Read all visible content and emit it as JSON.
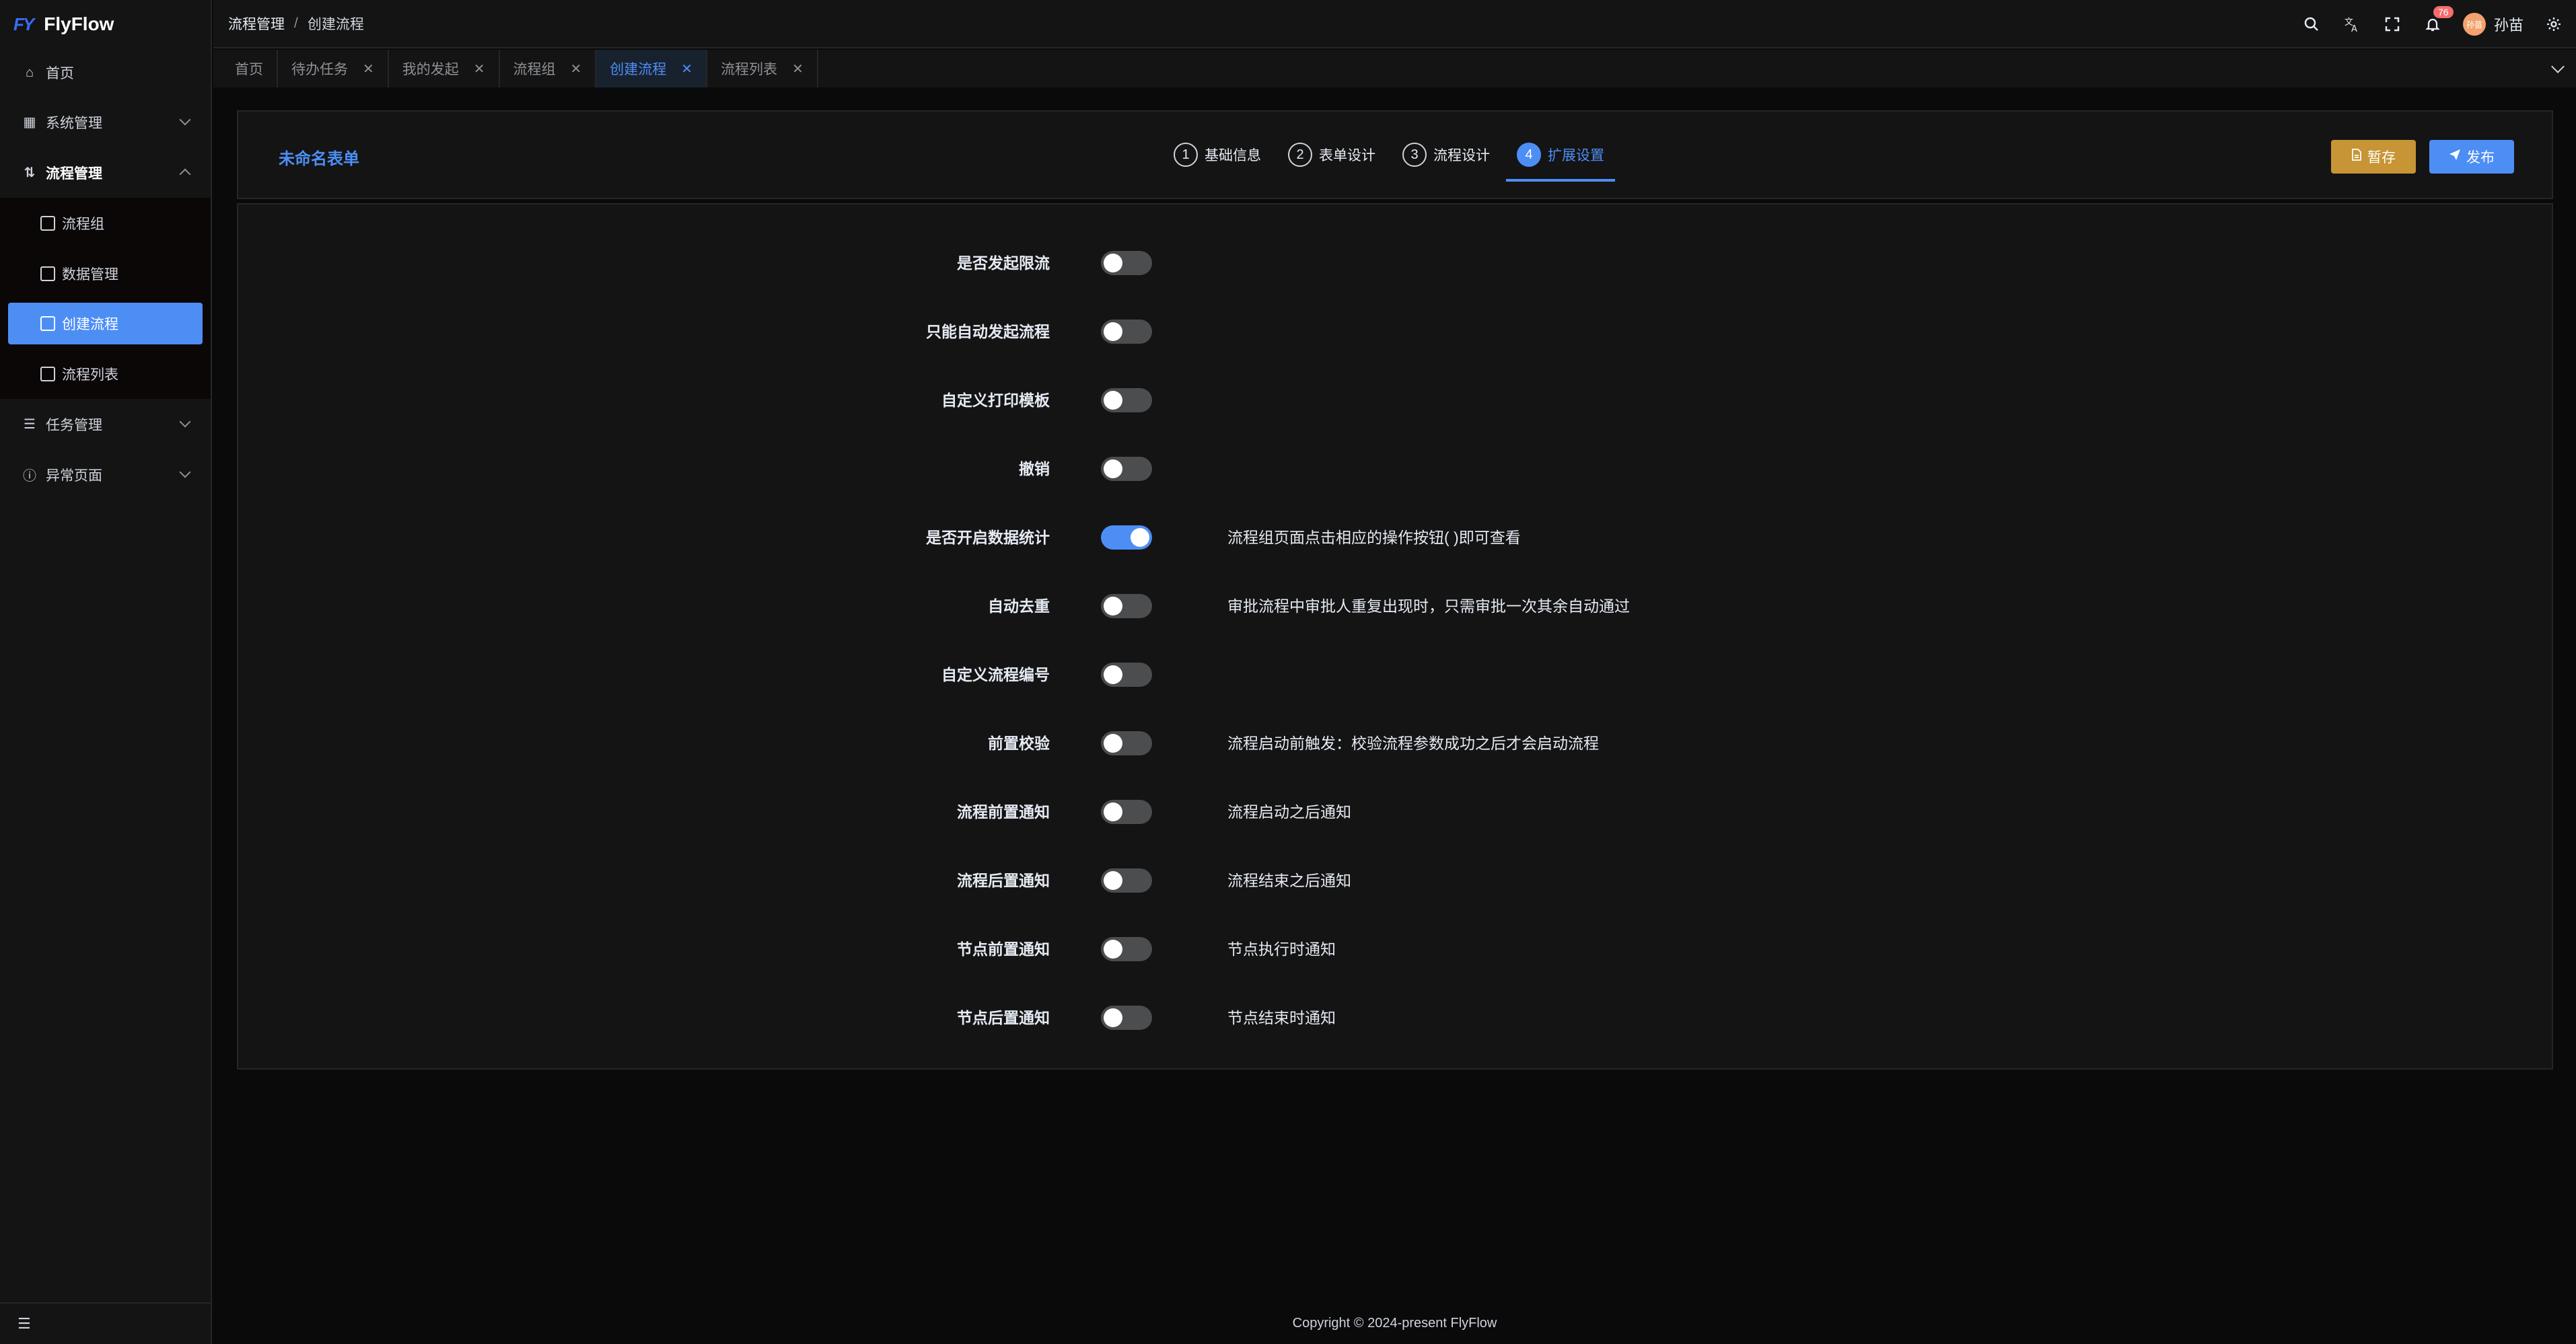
{
  "app": {
    "logo_mark": "FY",
    "name": "FlyFlow"
  },
  "sidebar": {
    "items": [
      {
        "label": "首页",
        "icon": "home-icon"
      },
      {
        "label": "系统管理",
        "icon": "grid-icon"
      },
      {
        "label": "流程管理",
        "icon": "flow-icon"
      },
      {
        "label": "任务管理",
        "icon": "list-icon"
      },
      {
        "label": "异常页面",
        "icon": "info-icon"
      }
    ],
    "sub_items": [
      {
        "label": "流程组"
      },
      {
        "label": "数据管理"
      },
      {
        "label": "创建流程"
      },
      {
        "label": "流程列表"
      }
    ],
    "collapse_icon": "menu-fold-icon"
  },
  "header": {
    "breadcrumb": [
      "流程管理",
      "创建流程"
    ],
    "separator": "/",
    "notification_count": "76",
    "avatar_text": "孙苗",
    "username": "孙苗"
  },
  "tabs": [
    {
      "label": "首页",
      "closable": false
    },
    {
      "label": "待办任务",
      "closable": true
    },
    {
      "label": "我的发起",
      "closable": true
    },
    {
      "label": "流程组",
      "closable": true
    },
    {
      "label": "创建流程",
      "closable": true,
      "active": true
    },
    {
      "label": "流程列表",
      "closable": true
    }
  ],
  "designer": {
    "form_title": "未命名表单",
    "steps": [
      {
        "num": "1",
        "label": "基础信息"
      },
      {
        "num": "2",
        "label": "表单设计"
      },
      {
        "num": "3",
        "label": "流程设计"
      },
      {
        "num": "4",
        "label": "扩展设置",
        "active": true
      }
    ],
    "save_label": "暂存",
    "publish_label": "发布"
  },
  "settings": [
    {
      "label": "是否发起限流",
      "on": false,
      "desc": ""
    },
    {
      "label": "只能自动发起流程",
      "on": false,
      "desc": ""
    },
    {
      "label": "自定义打印模板",
      "on": false,
      "desc": ""
    },
    {
      "label": "撤销",
      "on": false,
      "desc": ""
    },
    {
      "label": "是否开启数据统计",
      "on": true,
      "desc": "流程组页面点击相应的操作按钮(    )即可查看"
    },
    {
      "label": "自动去重",
      "on": false,
      "desc": "审批流程中审批人重复出现时，只需审批一次其余自动通过"
    },
    {
      "label": "自定义流程编号",
      "on": false,
      "desc": ""
    },
    {
      "label": "前置校验",
      "on": false,
      "desc": "流程启动前触发：校验流程参数成功之后才会启动流程"
    },
    {
      "label": "流程前置通知",
      "on": false,
      "desc": "流程启动之后通知"
    },
    {
      "label": "流程后置通知",
      "on": false,
      "desc": "流程结束之后通知"
    },
    {
      "label": "节点前置通知",
      "on": false,
      "desc": "节点执行时通知"
    },
    {
      "label": "节点后置通知",
      "on": false,
      "desc": "节点结束时通知"
    }
  ],
  "footer": {
    "copyright": "Copyright © 2024-present FlyFlow"
  },
  "colors": {
    "accent": "#4d8ef5",
    "save": "#c79535",
    "badge": "#f56c6c",
    "bg": "#0a0a0b",
    "panel": "#141414"
  }
}
